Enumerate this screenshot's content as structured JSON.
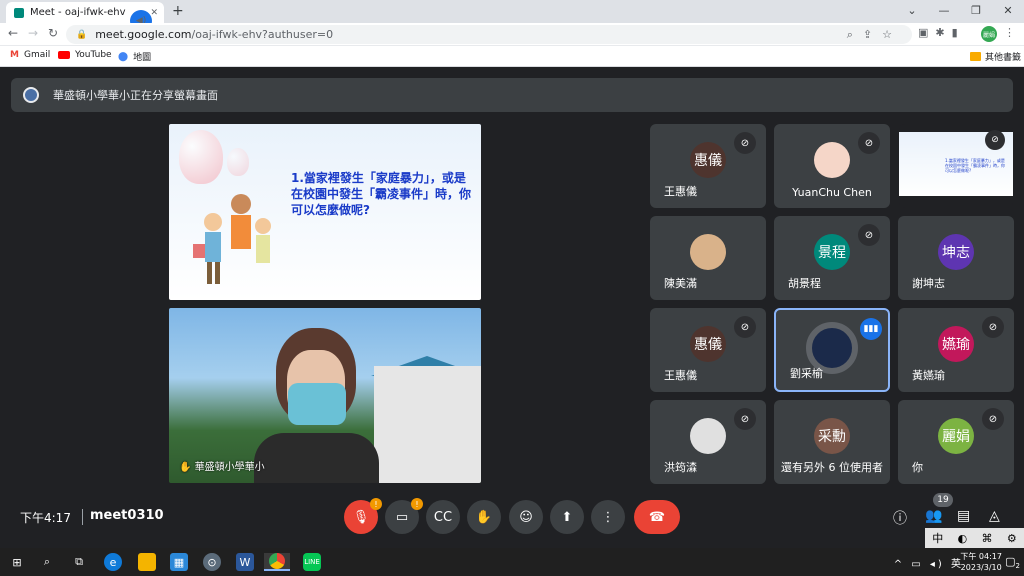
{
  "browser": {
    "tab_title": "Meet - oaj-ifwk-ehv",
    "url_host": "meet.google.com",
    "url_path": "/oaj-ifwk-ehv?authuser=0",
    "profile_label": "麗娟",
    "bookmarks": [
      "Gmail",
      "YouTube",
      "地圖"
    ],
    "other_bookmarks": "其他書籤"
  },
  "banner": {
    "text": "華盛頓小學華小正在分享螢幕畫面"
  },
  "presentation": {
    "slide_text": "1.當家裡發生「家庭暴力」，或是在校園中發生「霸凌事件」時，你可以怎麼做呢?",
    "camera_label": "華盛頓小學華小"
  },
  "participants": [
    {
      "name": "王惠儀",
      "avatar": "惠儀",
      "color": "#4e342e",
      "muted": true
    },
    {
      "name": "YuanChu Chen",
      "avatar": "",
      "color": "#f5d6c8",
      "muted": true
    },
    {
      "name": "陳美滿",
      "avatar": "",
      "color": "#d9b28a",
      "muted": false
    },
    {
      "name": "胡景程",
      "avatar": "景程",
      "color": "#00897b",
      "muted": true
    },
    {
      "name": "謝坤志",
      "avatar": "坤志",
      "color": "#5e35b1",
      "muted": false
    },
    {
      "name": "王惠儀",
      "avatar": "惠儀",
      "color": "#4e342e",
      "muted": true
    },
    {
      "name": "劉采榆",
      "avatar": "",
      "color": "#1b2a4a",
      "muted": false
    },
    {
      "name": "黃嬿瑜",
      "avatar": "嬿瑜",
      "color": "#c2185b",
      "muted": true
    },
    {
      "name": "洪筠潹",
      "avatar": "",
      "color": "#e0e0e0",
      "muted": true
    },
    {
      "name": "還有另外 6 位使用者",
      "avatar": "采勳",
      "color": "#795548",
      "muted": false
    },
    {
      "name": "你",
      "avatar": "麗娟",
      "color": "#7cb342",
      "muted": true
    }
  ],
  "bottom": {
    "time": "下午4:17",
    "meeting_code": "meet0310",
    "participant_count": "19"
  },
  "ime": {
    "lang": "中"
  },
  "taskbar": {
    "ime_char": "英",
    "clock_time": "下午 04:17",
    "clock_date": "2023/3/10",
    "notif_count": "2"
  }
}
